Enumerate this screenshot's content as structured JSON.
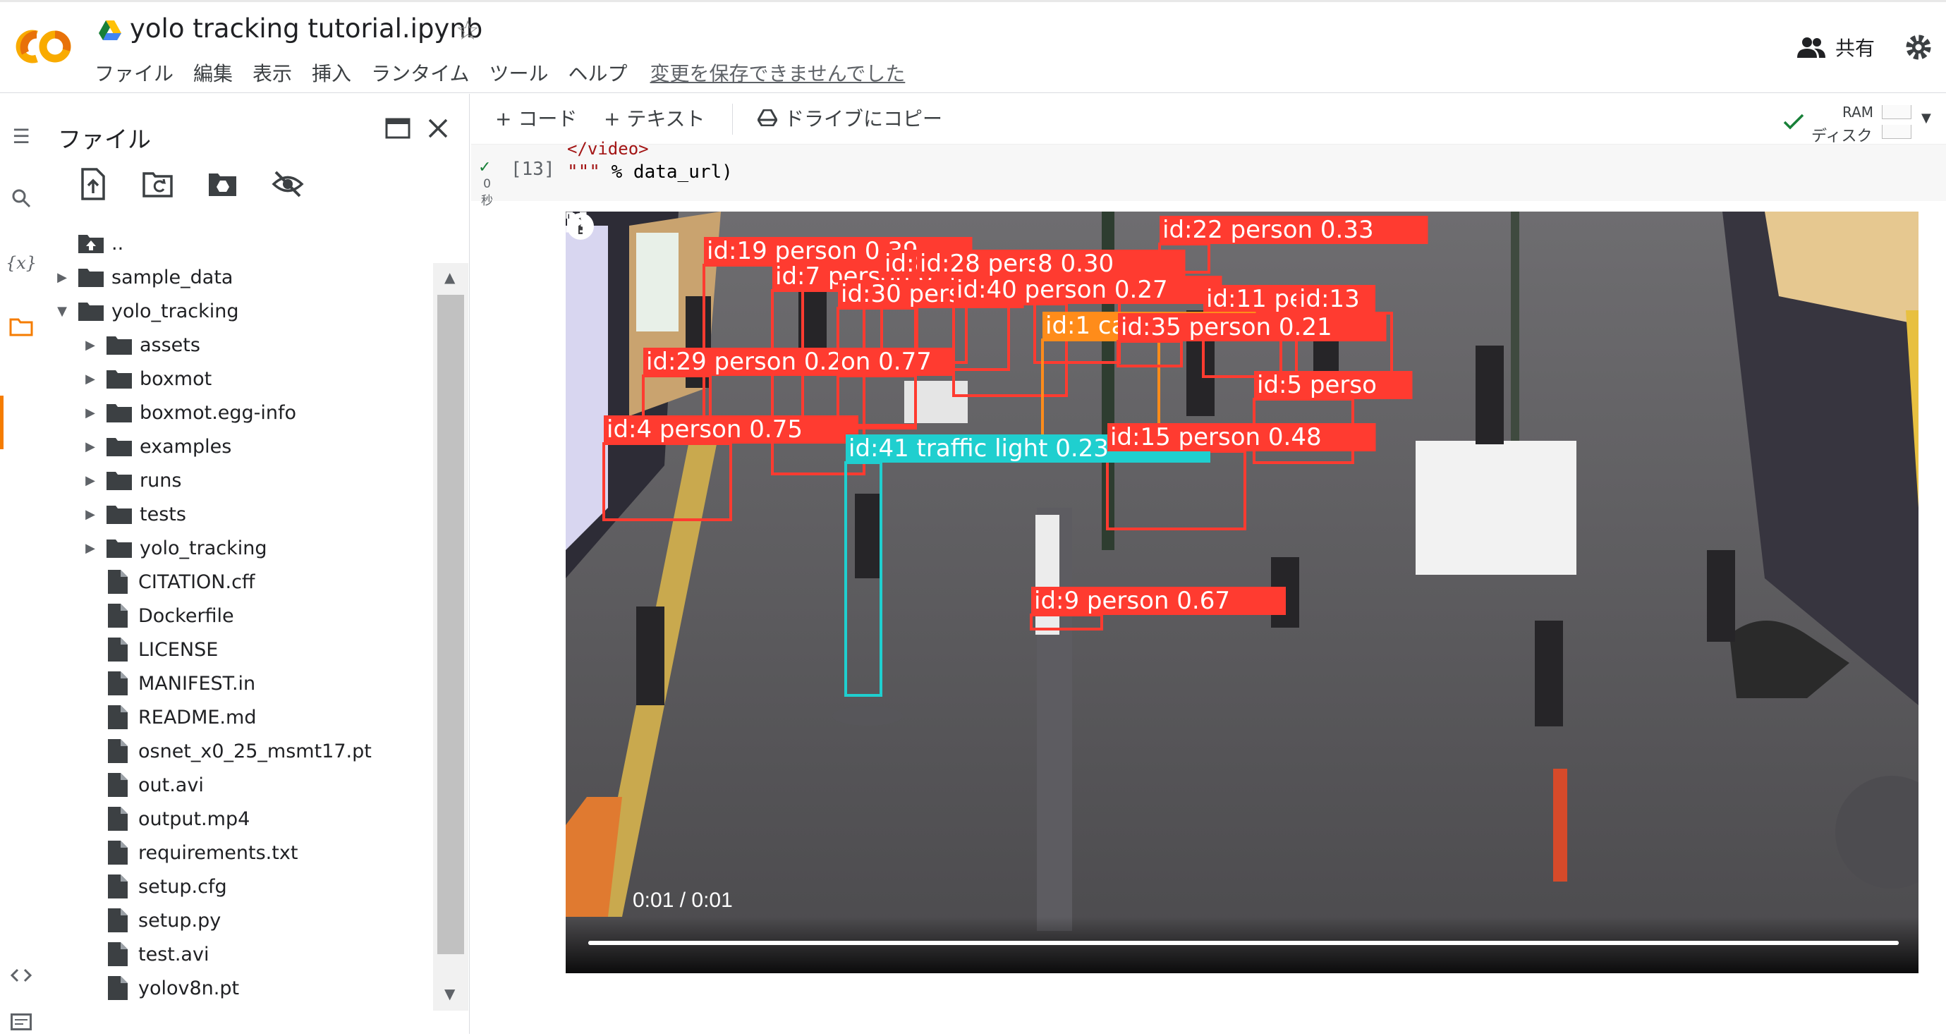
{
  "header": {
    "logo_text": "CO",
    "notebook_title": "yolo tracking tutorial.ipynb",
    "menu": [
      "ファイル",
      "編集",
      "表示",
      "挿入",
      "ランタイム",
      "ツール",
      "ヘルプ"
    ],
    "save_warning": "変更を保存できませんでした",
    "share_label": "共有"
  },
  "toolbar": {
    "add_code": "+ コード",
    "add_text": "+ テキスト",
    "copy_to_drive": "ドライブにコピー",
    "ram_label": "RAM",
    "disk_label": "ディスク"
  },
  "files_panel": {
    "title": "ファイル",
    "tree": [
      {
        "name": "..",
        "kind": "up",
        "depth": 0
      },
      {
        "name": "sample_data",
        "kind": "folder",
        "depth": 0,
        "expanded": false
      },
      {
        "name": "yolo_tracking",
        "kind": "folder",
        "depth": 0,
        "expanded": true
      },
      {
        "name": "assets",
        "kind": "folder",
        "depth": 1,
        "expanded": false
      },
      {
        "name": "boxmot",
        "kind": "folder",
        "depth": 1,
        "expanded": false
      },
      {
        "name": "boxmot.egg-info",
        "kind": "folder",
        "depth": 1,
        "expanded": false
      },
      {
        "name": "examples",
        "kind": "folder",
        "depth": 1,
        "expanded": false
      },
      {
        "name": "runs",
        "kind": "folder",
        "depth": 1,
        "expanded": false
      },
      {
        "name": "tests",
        "kind": "folder",
        "depth": 1,
        "expanded": false
      },
      {
        "name": "yolo_tracking",
        "kind": "folder",
        "depth": 1,
        "expanded": false
      },
      {
        "name": "CITATION.cff",
        "kind": "file",
        "depth": 1
      },
      {
        "name": "Dockerfile",
        "kind": "file",
        "depth": 1
      },
      {
        "name": "LICENSE",
        "kind": "file",
        "depth": 1
      },
      {
        "name": "MANIFEST.in",
        "kind": "file",
        "depth": 1
      },
      {
        "name": "README.md",
        "kind": "file",
        "depth": 1
      },
      {
        "name": "osnet_x0_25_msmt17.pt",
        "kind": "file",
        "depth": 1
      },
      {
        "name": "out.avi",
        "kind": "file",
        "depth": 1
      },
      {
        "name": "output.mp4",
        "kind": "file",
        "depth": 1
      },
      {
        "name": "requirements.txt",
        "kind": "file",
        "depth": 1
      },
      {
        "name": "setup.cfg",
        "kind": "file",
        "depth": 1
      },
      {
        "name": "setup.py",
        "kind": "file",
        "depth": 1
      },
      {
        "name": "test.avi",
        "kind": "file",
        "depth": 1
      },
      {
        "name": "yolov8n.pt",
        "kind": "file",
        "depth": 1
      }
    ]
  },
  "cell": {
    "exec_count": "[13]",
    "exec_time_value": "0",
    "exec_time_unit": "秒",
    "code_prev_line": "</video>",
    "code_quote": "\"\"\"",
    "code_rest": " % data_url)"
  },
  "video": {
    "time_text": "0:01 / 0:01",
    "progress": 1.0,
    "detections": [
      {
        "label": "id:19  person  0.39",
        "color": "#ff3b30"
      },
      {
        "label": "id:7  person  0.35",
        "color": "#ff3b30"
      },
      {
        "label": "id:8",
        "color": "#ff3b30"
      },
      {
        "label": "id:28  person  0.36",
        "color": "#ff3b30"
      },
      {
        "label": "8  0.30",
        "color": "#ff3b30"
      },
      {
        "label": "id:22  person  0.33",
        "color": "#ff3b30"
      },
      {
        "label": "id:30  person",
        "color": "#ff3b30"
      },
      {
        "label": "id:40  person  0.27",
        "color": "#ff3b30"
      },
      {
        "label": "id:11  persc",
        "color": "#ff3b30"
      },
      {
        "label": "id:13",
        "color": "#ff3b30"
      },
      {
        "label": "id:1  car  0.73",
        "color": "#ff8c1a"
      },
      {
        "label": "id:35  person  0.21",
        "color": "#ff3b30"
      },
      {
        "label": "id:29  person  0.20",
        "color": "#ff3b30"
      },
      {
        "label": "on  0.77",
        "color": "#ff3b30"
      },
      {
        "label": "id:5  perso",
        "color": "#ff3b30"
      },
      {
        "label": "id:4  person  0.75",
        "color": "#ff3b30"
      },
      {
        "label": "id:41  traffic light  0.23",
        "color": "#1fcfcf"
      },
      {
        "label": "id:15  person  0.48",
        "color": "#ff3b30"
      },
      {
        "label": "id:9  person  0.67",
        "color": "#ff3b30"
      }
    ]
  },
  "colors": {
    "accent": "#f57c00",
    "check": "#188038",
    "box_person": "#ff3b30",
    "box_car": "#ff8c1a",
    "box_traffic_light": "#1fcfcf"
  },
  "icons": [
    "drive-icon",
    "star-icon",
    "people-icon",
    "gear-icon",
    "toc-icon",
    "search-icon",
    "variables-icon",
    "folder-icon",
    "code-snippets-icon",
    "terminal-icon",
    "upload-icon",
    "refresh-icon",
    "mount-drive-icon",
    "hide-icon",
    "new-window-icon",
    "close-icon",
    "check-icon",
    "play-icon",
    "volume-icon",
    "fullscreen-icon",
    "more-vert-icon",
    "info-icon"
  ]
}
